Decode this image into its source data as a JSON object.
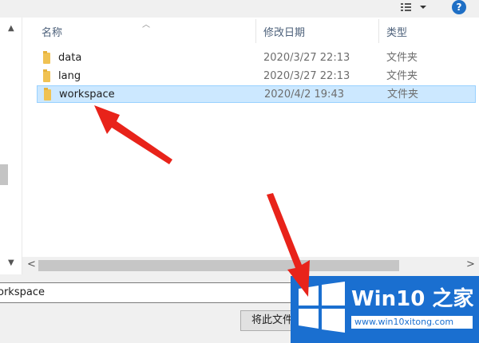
{
  "toolbar": {
    "help_label": "?"
  },
  "columns": {
    "name": "名称",
    "date": "修改日期",
    "type": "类型"
  },
  "files": [
    {
      "name": "data",
      "date": "2020/3/27 22:13",
      "type": "文件夹",
      "selected": false
    },
    {
      "name": "lang",
      "date": "2020/3/27 22:13",
      "type": "文件夹",
      "selected": false
    },
    {
      "name": "workspace",
      "date": "2020/4/2 19:43",
      "type": "文件夹",
      "selected": true
    }
  ],
  "filename_field": {
    "value": "orkspace"
  },
  "buttons": {
    "select_folder": "将此文件"
  },
  "watermark": {
    "title": "Win10 之家",
    "url": "www.win10xitong.com"
  },
  "colors": {
    "selection": "#cce8ff",
    "annotation": "#e8231a",
    "badge": "#1a6fd0"
  }
}
